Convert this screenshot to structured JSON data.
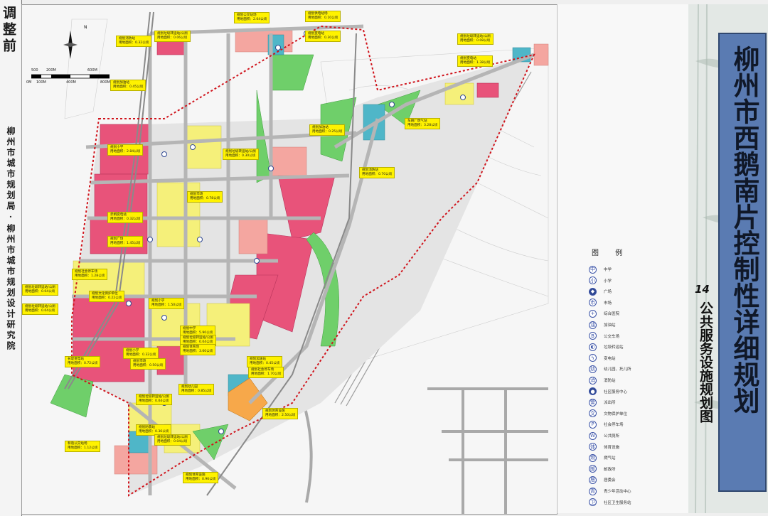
{
  "side_stamp": "调整前",
  "side_department": "柳州市城市规划局·柳州市城市规划设计研究院",
  "title": "柳州市西鹅南片控制性详细规划",
  "sheet_number": "14",
  "sheet_name": "公共服务设施规划图",
  "north_label": "N",
  "scale_bar": {
    "top": [
      "500",
      "200M",
      "600M"
    ],
    "bottom": [
      "0M",
      "100M",
      "400M",
      "800M"
    ]
  },
  "legend": {
    "title": "图 例",
    "items": [
      {
        "label": "中学",
        "icon": "school-icon",
        "glyph": "中"
      },
      {
        "label": "小学",
        "icon": "school-icon",
        "glyph": "小"
      },
      {
        "label": "广场",
        "icon": "plaza-icon",
        "glyph": "◆"
      },
      {
        "label": "市场",
        "icon": "market-icon",
        "glyph": "市"
      },
      {
        "label": "综合医院",
        "icon": "hospital-icon",
        "glyph": "+"
      },
      {
        "label": "加油站",
        "icon": "gas-station-icon",
        "glyph": "油"
      },
      {
        "label": "公交车场",
        "icon": "bus-icon",
        "glyph": "B"
      },
      {
        "label": "垃圾转运站",
        "icon": "waste-icon",
        "glyph": "◐"
      },
      {
        "label": "变电站",
        "icon": "substation-icon",
        "glyph": "ϟ"
      },
      {
        "label": "幼儿园、托儿所",
        "icon": "kindergarten-icon",
        "glyph": "幼"
      },
      {
        "label": "消防站",
        "icon": "fire-station-icon",
        "glyph": "消"
      },
      {
        "label": "社区服务中心",
        "icon": "community-center-icon",
        "glyph": "●"
      },
      {
        "label": "派出所",
        "icon": "police-icon",
        "glyph": "警"
      },
      {
        "label": "文物保护单位",
        "icon": "heritage-icon",
        "glyph": "文"
      },
      {
        "label": "社会停车场",
        "icon": "parking-icon",
        "glyph": "P"
      },
      {
        "label": "公共厕所",
        "icon": "toilet-icon",
        "glyph": "W"
      },
      {
        "label": "体育设施",
        "icon": "sports-icon",
        "glyph": "体"
      },
      {
        "label": "燃气站",
        "icon": "gas-icon",
        "glyph": "燃"
      },
      {
        "label": "邮政所",
        "icon": "post-icon",
        "glyph": "邮"
      },
      {
        "label": "居委会",
        "icon": "residents-committee-icon",
        "glyph": "居"
      },
      {
        "label": "青少年活动中心",
        "icon": "youth-center-icon",
        "glyph": "青"
      },
      {
        "label": "社区卫生服务站",
        "icon": "clinic-icon",
        "glyph": "卫"
      }
    ]
  },
  "map_labels": [
    {
      "id": "lbl-01",
      "lines": [
        "规划消防站",
        "用地面积：0.32公顷"
      ]
    },
    {
      "id": "lbl-02",
      "lines": [
        "规划垃圾转运站/公厕",
        "用地面积：0.06公顷"
      ]
    },
    {
      "id": "lbl-03",
      "lines": [
        "规划公交站场",
        "用地面积：2.04公顷"
      ]
    },
    {
      "id": "lbl-04",
      "lines": [
        "规划供电站场",
        "用地面积：0.10公顷"
      ]
    },
    {
      "id": "lbl-05",
      "lines": [
        "规划变电站",
        "用地面积：0.30公顷"
      ]
    },
    {
      "id": "lbl-06",
      "lines": [
        "规划垃圾转运站/公厕",
        "用地面积：0.08公顷"
      ]
    },
    {
      "id": "lbl-07",
      "lines": [
        "规划变电站",
        "用地面积：1.38公顷"
      ]
    },
    {
      "id": "lbl-08",
      "lines": [
        "规划加油站",
        "用地面积：0.45公顷"
      ]
    },
    {
      "id": "lbl-09",
      "lines": [
        "规划加油站",
        "用地面积：0.25公顷"
      ]
    },
    {
      "id": "lbl-10",
      "lines": [
        "车辆厂燃气站",
        "用地面积：3.28公顷"
      ]
    },
    {
      "id": "lbl-11",
      "lines": [
        "规划小学",
        "用地面积：2.84公顷"
      ]
    },
    {
      "id": "lbl-12",
      "lines": [
        "规划垃圾转运站/公厕",
        "用地面积：0.30公顷"
      ]
    },
    {
      "id": "lbl-13",
      "lines": [
        "规划消防站",
        "用地面积：0.70公顷"
      ]
    },
    {
      "id": "lbl-14",
      "lines": [
        "规划市场",
        "用地面积：0.78公顷"
      ]
    },
    {
      "id": "lbl-15",
      "lines": [
        "赤桐变电站",
        "用地面积：0.32公顷"
      ]
    },
    {
      "id": "lbl-16",
      "lines": [
        "规划垃圾转运站/公厕",
        "用地面积：0.04公顷"
      ]
    },
    {
      "id": "lbl-17",
      "lines": [
        "规划广场",
        "用地面积：1.45公顷"
      ]
    },
    {
      "id": "lbl-18",
      "lines": [
        "规划社会停车场",
        "用地面积：1.28公顷"
      ]
    },
    {
      "id": "lbl-19",
      "lines": [
        "规划垃圾转运站/公厕",
        "用地面积：0.04公顷"
      ]
    },
    {
      "id": "lbl-20",
      "lines": [
        "规划小学",
        "用地面积：1.50公顷"
      ]
    },
    {
      "id": "lbl-21",
      "lines": [
        "规划文化保护单位",
        "用地面积：0.22公顷"
      ]
    },
    {
      "id": "lbl-22",
      "lines": [
        "规划中学",
        "用地面积：5.90公顷"
      ]
    },
    {
      "id": "lbl-23",
      "lines": [
        "规划垃圾转运站/公厕",
        "用地面积：0.04公顷"
      ]
    },
    {
      "id": "lbl-24",
      "lines": [
        "规划体育场",
        "用地面积：3.60公顷"
      ]
    },
    {
      "id": "lbl-25",
      "lines": [
        "规划小学",
        "用地面积：0.32公顷"
      ]
    },
    {
      "id": "lbl-26",
      "lines": [
        "长堤变电站",
        "用地面积：0.72公顷"
      ]
    },
    {
      "id": "lbl-27",
      "lines": [
        "规划市场",
        "用地面积：0.50公顷"
      ]
    },
    {
      "id": "lbl-28",
      "lines": [
        "规划加油站",
        "用地面积：0.45公顷"
      ]
    },
    {
      "id": "lbl-29",
      "lines": [
        "规划幼儿园",
        "用地面积：0.85公顷"
      ]
    },
    {
      "id": "lbl-30",
      "lines": [
        "规划社会停车场",
        "用地面积：1.70公顷"
      ]
    },
    {
      "id": "lbl-31",
      "lines": [
        "规划垃圾转运站/公厕",
        "用地面积：0.04公顷"
      ]
    },
    {
      "id": "lbl-32",
      "lines": [
        "规划体育设施",
        "用地面积：2.50公顷"
      ]
    },
    {
      "id": "lbl-33",
      "lines": [
        "规划防震站",
        "用地面积：0.36公顷"
      ]
    },
    {
      "id": "lbl-34",
      "lines": [
        "规划垃圾转运站/公厕",
        "用地面积：0.04公顷"
      ]
    },
    {
      "id": "lbl-35",
      "lines": [
        "和谐公交站场",
        "用地面积：1.12公顷"
      ]
    },
    {
      "id": "lbl-36",
      "lines": [
        "规划体育设施",
        "用地面积：0.96公顷"
      ]
    }
  ],
  "colors": {
    "commercial": "#e8537a",
    "residential": "#f5f07a",
    "public_green": "#6fcf6a",
    "utilities": "#4fb6c8",
    "education": "#f4a6a0",
    "sports": "#f7a84a",
    "boundary": "#d0141c",
    "title_panel": "#5a7bb2"
  }
}
